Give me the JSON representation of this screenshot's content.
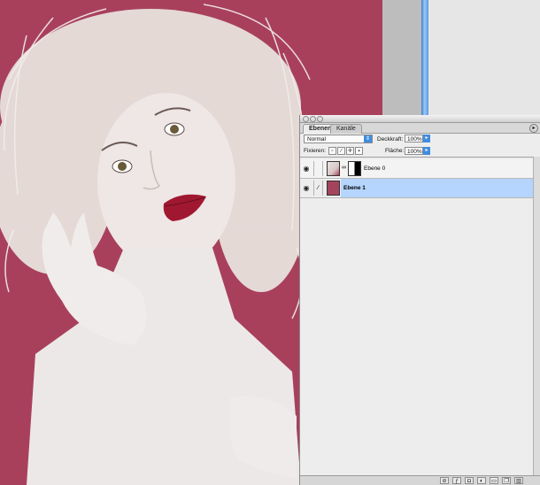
{
  "panel": {
    "tabs": [
      {
        "label": "Ebenen",
        "active": true
      },
      {
        "label": "Kanäle",
        "active": false
      }
    ],
    "blend_mode": "Normal",
    "opacity_label": "Deckkraft:",
    "opacity_value": "100%",
    "lock_label": "Fixieren:",
    "fill_label": "Fläche:",
    "fill_value": "100%",
    "layers": [
      {
        "name": "Ebene 0",
        "visible": true,
        "selected": false
      },
      {
        "name": "Ebene 1",
        "visible": true,
        "selected": true
      }
    ]
  },
  "colors": {
    "canvas_bg": "#a8405c",
    "layer_thumb": "#a4435e",
    "selection": "#b5d5ff",
    "accent": "#3f8de0"
  },
  "icons": {
    "visibility": "eye-icon",
    "brush": "brush-icon",
    "link": "chain-link-icon",
    "lock_transparency": "lock-transparency-icon",
    "lock_image": "lock-image-icon",
    "lock_position": "lock-position-icon",
    "lock_all": "lock-all-icon"
  }
}
